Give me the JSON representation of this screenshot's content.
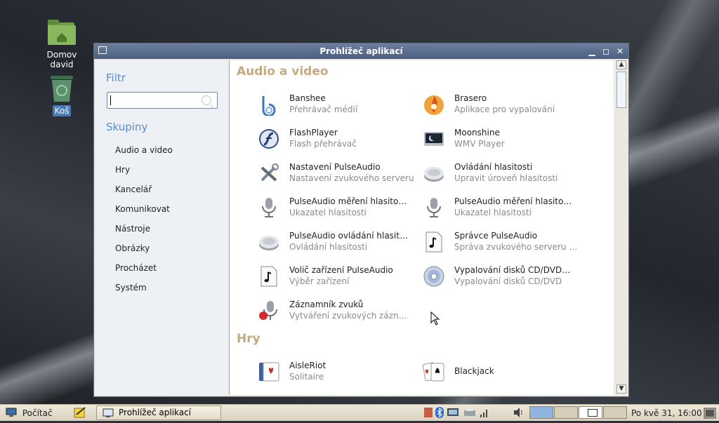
{
  "desktop": {
    "icons": [
      {
        "label": "Domov david",
        "icon": "home-folder-icon"
      },
      {
        "label": "Koš",
        "icon": "trash-icon"
      }
    ]
  },
  "window": {
    "title": "Prohlížeč aplikací",
    "controls": [
      "minimize",
      "maximize",
      "close"
    ]
  },
  "sidebar": {
    "filter_heading": "Filtr",
    "search_value": "",
    "groups_heading": "Skupiny",
    "groups": [
      "Audio a video",
      "Hry",
      "Kancelář",
      "Komunikovat",
      "Nástroje",
      "Obrázky",
      "Procházet",
      "Systém"
    ]
  },
  "content": {
    "sections": [
      {
        "title": "Audio a video",
        "apps": [
          {
            "name": "Banshee",
            "desc": "Přehrávač médií",
            "icon": "banshee-icon"
          },
          {
            "name": "Brasero",
            "desc": "Aplikace pro vypalování",
            "icon": "brasero-icon"
          },
          {
            "name": "FlashPlayer",
            "desc": "Flash přehrávač",
            "icon": "flash-icon"
          },
          {
            "name": "Moonshine",
            "desc": "WMV Player",
            "icon": "moonshine-icon"
          },
          {
            "name": "Nastavení PulseAudio",
            "desc": "Nastavení zvukového serveru",
            "icon": "tools-icon"
          },
          {
            "name": "Ovládání hlasitosti",
            "desc": "Upravit úroveň hlasitosti",
            "icon": "volume-knob-icon"
          },
          {
            "name": "PulseAudio měření hlasito…",
            "desc": "Ukazatel hlasitosti",
            "icon": "microphone-icon"
          },
          {
            "name": "PulseAudio měření hlasito…",
            "desc": "Ukazatel hlasitosti",
            "icon": "microphone-icon"
          },
          {
            "name": "PulseAudio ovládání hlasit…",
            "desc": "Ovládání hlasitosti",
            "icon": "volume-knob-icon"
          },
          {
            "name": "Správce PulseAudio",
            "desc": "Správa zvukového serveru …",
            "icon": "music-note-icon"
          },
          {
            "name": "Volič zařízení PulseAudio",
            "desc": "Výběr zařízení",
            "icon": "music-note-icon"
          },
          {
            "name": "Vypalování disků CD/DVD…",
            "desc": "Vypalování disků CD/DVD",
            "icon": "cd-disc-icon"
          },
          {
            "name": "Záznamník zvuků",
            "desc": "Vytváření zvukových zázn…",
            "icon": "sound-recorder-icon"
          }
        ]
      },
      {
        "title": "Hry",
        "apps": [
          {
            "name": "AisleRiot",
            "desc": "Solitaire",
            "icon": "cards-icon"
          },
          {
            "name": "Blackjack",
            "desc": "",
            "icon": "blackjack-icon"
          }
        ]
      }
    ]
  },
  "panel": {
    "computer_label": "Počítač",
    "task_label": "Prohlížeč aplikací",
    "clock": "Po kvě 31, 16:00"
  },
  "colors": {
    "section_heading": "#c3ab7f",
    "sidebar_heading": "#5d8bc4",
    "titlebar": "#5a6c8d"
  }
}
